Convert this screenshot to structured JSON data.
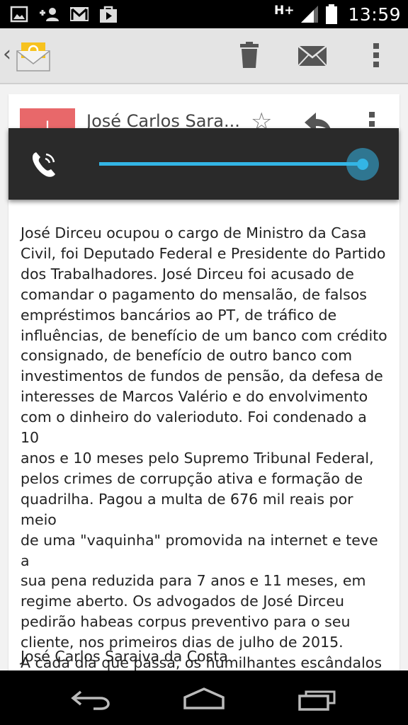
{
  "status_bar": {
    "network_type": "H+",
    "time": "13:59"
  },
  "action_bar": {
    "up_glyph": "‹",
    "icons": [
      "email-app-icon",
      "delete-icon",
      "mark-unread-icon",
      "overflow-menu-icon"
    ]
  },
  "message": {
    "sender_initial": "J",
    "sender_name": "José Carlos Sara...",
    "star_glyph": "☆",
    "body": "José Dirceu ocupou o cargo de Ministro da Casa\nCivil, foi Deputado Federal e Presidente do Partido\ndos Trabalhadores. José Dirceu foi acusado de\ncomandar o pagamento do mensalão, de falsos\nempréstimos bancários ao PT, de tráfico de\ninfluências, de benefício de um banco com crédito\nconsignado, de benefício de outro banco com\ninvestimentos de fundos de pensão, da defesa de\ninteresses de Marcos Valério e do envolvimento\ncom o dinheiro do valerioduto. Foi condenado a 10\nanos e 10 meses pelo Supremo Tribunal Federal,\npelos crimes de corrupção ativa e formação de\nquadrilha. Pagou a multa de 676 mil reais por meio\nde uma \"vaquinha\" promovida na internet e teve a\nsua pena reduzida para 7 anos e 11 meses, em\nregime aberto. Os advogados de José Dirceu\npedirão habeas corpus preventivo para o seu\ncliente, nos primeiros dias de julho de 2015.\nA cada dia que passa, os humilhantes escândalos\nde corrupção estão desmantelando o PT.",
    "signature": "José Carlos Saraiva da Costa"
  },
  "volume_dialog": {
    "stream_icon": "in-call-volume-icon",
    "level_fraction": 1.0,
    "accent_color": "#33b5e5"
  },
  "nav_bar": {
    "buttons": [
      "back-icon",
      "home-icon",
      "recent-apps-icon"
    ]
  },
  "colors": {
    "avatar": "#e8686a",
    "accent": "#33b5e5"
  }
}
